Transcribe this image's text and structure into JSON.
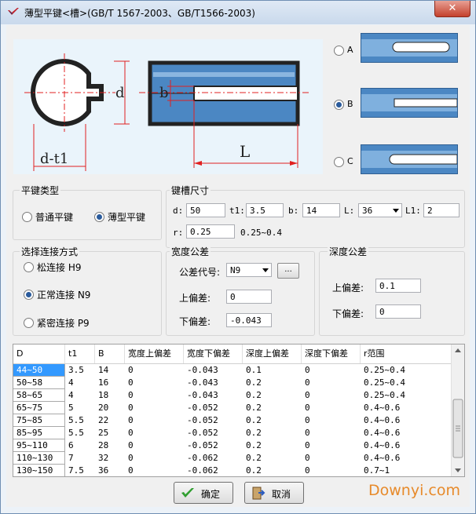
{
  "window": {
    "title": "薄型平键<槽>(GB/T 1567-2003、GB/T1566-2003)",
    "close_label": "✕"
  },
  "diagram": {
    "labels": {
      "b": "b",
      "d": "d",
      "d_t1": "d-t1",
      "L": "L"
    }
  },
  "options": [
    {
      "letter": "A",
      "selected": false
    },
    {
      "letter": "B",
      "selected": true
    },
    {
      "letter": "C",
      "selected": false
    }
  ],
  "key_type": {
    "title": "平键类型",
    "options": [
      {
        "label": "普通平键",
        "selected": false
      },
      {
        "label": "薄型平键",
        "selected": true
      }
    ]
  },
  "slot_size": {
    "title": "键槽尺寸",
    "d_label": "d:",
    "d_value": "50",
    "t1_label": "t1:",
    "t1_value": "3.5",
    "b_label": "b:",
    "b_value": "14",
    "L_label": "L:",
    "L_value": "36",
    "L1_label": "L1:",
    "L1_value": "2",
    "r_label": "r:",
    "r_value": "0.25",
    "r_range": "0.25~0.4"
  },
  "connection": {
    "title": "选择连接方式",
    "options": [
      {
        "label": "松连接 H9",
        "selected": false
      },
      {
        "label": "正常连接 N9",
        "selected": true
      },
      {
        "label": "紧密连接 P9",
        "selected": false
      }
    ]
  },
  "width_tol": {
    "title": "宽度公差",
    "code_label": "公差代号:",
    "code_value": "N9",
    "dots_label": "...",
    "upper_label": "上偏差:",
    "upper_value": "0",
    "lower_label": "下偏差:",
    "lower_value": "-0.043"
  },
  "depth_tol": {
    "title": "深度公差",
    "upper_label": "上偏差:",
    "upper_value": "0.1",
    "lower_label": "下偏差:",
    "lower_value": "0"
  },
  "table": {
    "headers": [
      "D",
      "t1",
      "B",
      "宽度上偏差",
      "宽度下偏差",
      "深度上偏差",
      "深度下偏差",
      "r范围"
    ],
    "rows": [
      [
        "44~50",
        "3.5",
        "14",
        "0",
        "-0.043",
        "0.1",
        "0",
        "0.25~0.4"
      ],
      [
        "50~58",
        "4",
        "16",
        "0",
        "-0.043",
        "0.2",
        "0",
        "0.25~0.4"
      ],
      [
        "58~65",
        "4",
        "18",
        "0",
        "-0.043",
        "0.2",
        "0",
        "0.25~0.4"
      ],
      [
        "65~75",
        "5",
        "20",
        "0",
        "-0.052",
        "0.2",
        "0",
        "0.4~0.6"
      ],
      [
        "75~85",
        "5.5",
        "22",
        "0",
        "-0.052",
        "0.2",
        "0",
        "0.4~0.6"
      ],
      [
        "85~95",
        "5.5",
        "25",
        "0",
        "-0.052",
        "0.2",
        "0",
        "0.4~0.6"
      ],
      [
        "95~110",
        "6",
        "28",
        "0",
        "-0.052",
        "0.2",
        "0",
        "0.4~0.6"
      ],
      [
        "110~130",
        "7",
        "32",
        "0",
        "-0.062",
        "0.2",
        "0",
        "0.4~0.6"
      ],
      [
        "130~150",
        "7.5",
        "36",
        "0",
        "-0.062",
        "0.2",
        "0",
        "0.7~1"
      ]
    ],
    "selected_row": 0
  },
  "buttons": {
    "ok": "确定",
    "cancel": "取消"
  },
  "watermark": "Downyi.com",
  "colors": {
    "accent": "#3399ff",
    "dim_red": "#e02020",
    "part_blue": "#4b87c3"
  }
}
